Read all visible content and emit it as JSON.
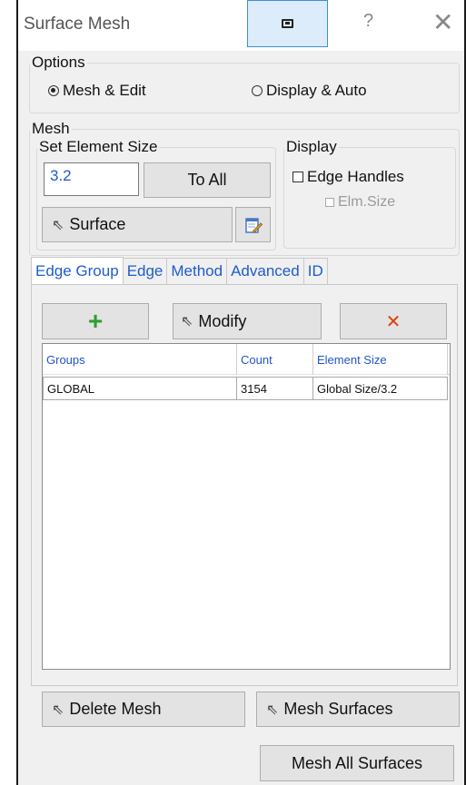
{
  "window": {
    "title": "Surface Mesh",
    "help_glyph": "?",
    "close_glyph": "✕"
  },
  "options": {
    "legend": "Options",
    "radio_mesh_edit": "Mesh & Edit",
    "radio_display_auto": "Display & Auto",
    "selected": "Mesh & Edit"
  },
  "mesh": {
    "legend": "Mesh",
    "set_element_size": {
      "legend": "Set Element Size",
      "value": "3.2",
      "to_all_label": "To All",
      "surface_label": "Surface"
    },
    "display": {
      "legend": "Display",
      "edge_handles_label": "Edge Handles",
      "edge_handles_checked": false,
      "elm_size_label": "Elm.Size",
      "elm_size_enabled": false
    }
  },
  "tabs": [
    "Edge Group",
    "Edge",
    "Method",
    "Advanced",
    "ID"
  ],
  "active_tab": "Edge Group",
  "edge_group": {
    "add_glyph": "+",
    "modify_label": "Modify",
    "delete_glyph": "✕",
    "table": {
      "columns": [
        "Groups",
        "Count",
        "Element Size"
      ],
      "rows": [
        {
          "group": "GLOBAL",
          "count": "3154",
          "element_size": "Global Size/3.2"
        }
      ]
    }
  },
  "footer": {
    "delete_mesh_label": "Delete Mesh",
    "mesh_surfaces_label": "Mesh Surfaces",
    "mesh_all_surfaces_label": "Mesh All Surfaces"
  },
  "colors": {
    "accent_blue": "#1e5ccf",
    "add_green": "#2e9e2e",
    "delete_red": "#e04010",
    "pin_highlight": "#dcecfb"
  },
  "icons": {
    "pointer": "cursor-arrow-icon",
    "edit": "notepad-edit-icon"
  }
}
